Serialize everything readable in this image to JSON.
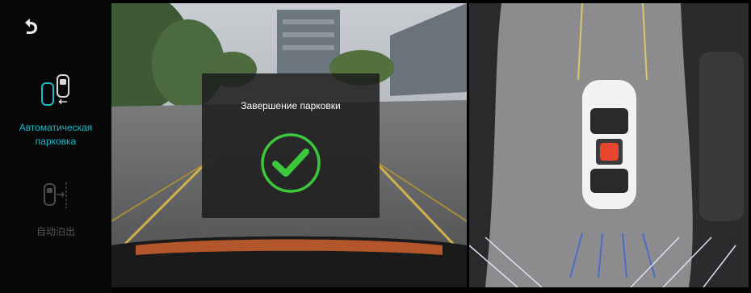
{
  "sidebar": {
    "back_icon": "back-arrow-icon",
    "modes": [
      {
        "label_line1": "Автоматическая",
        "label_line2": "парковка",
        "icon": "auto-park-icon",
        "active": true
      },
      {
        "label": "自动泊出",
        "icon": "auto-exit-icon",
        "active": false
      }
    ]
  },
  "dialog": {
    "title": "Завершение парковки",
    "icon": "check-circle-icon"
  },
  "colors": {
    "accent": "#1fb8c8",
    "success": "#3cc83c",
    "brake_indicator": "#e8452c"
  }
}
